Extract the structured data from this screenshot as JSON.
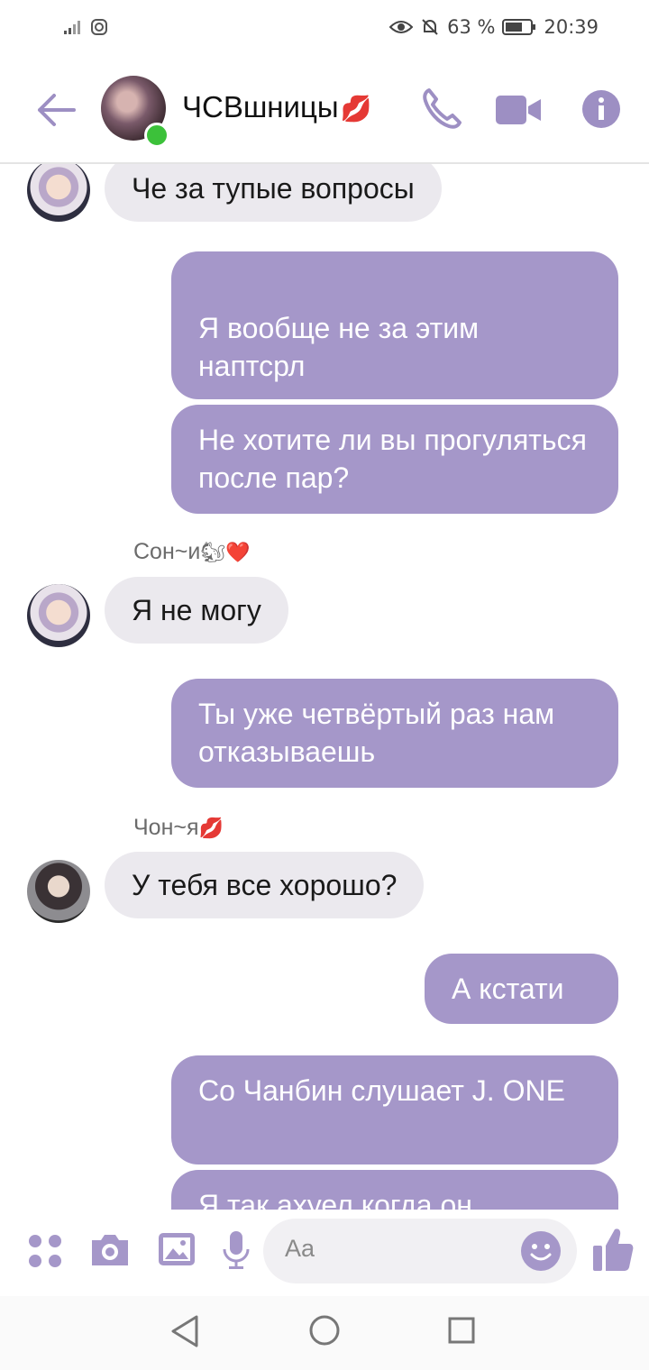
{
  "status_bar": {
    "battery": "63 %",
    "time": "20:39",
    "icons": [
      "signal-icon",
      "instagram-icon",
      "eye-icon",
      "bell-muted-icon",
      "battery-icon"
    ]
  },
  "header": {
    "title": "ЧСВшницы",
    "title_emoji": "💋",
    "icons": [
      "back-arrow-icon",
      "phone-icon",
      "video-camera-icon",
      "info-icon"
    ],
    "accent_color": "#a597c9"
  },
  "messages": [
    {
      "side": "in",
      "sender": "",
      "text": "Че за тупые вопросы"
    },
    {
      "side": "out",
      "text": "Я вообще не за этим наптсрл"
    },
    {
      "side": "out",
      "text": "Не хотите ли вы прогуляться после пар?"
    },
    {
      "side": "in",
      "sender": "Сон~и",
      "sender_emoji": "🐿❤️",
      "text": "Я не могу"
    },
    {
      "side": "out",
      "text": "Ты уже четвёртый раз нам отказываешь"
    },
    {
      "side": "in",
      "sender": "Чон~я",
      "sender_emoji": "💋",
      "text": "У тебя все хорошо?"
    },
    {
      "side": "out",
      "text": "А кстати"
    },
    {
      "side": "out",
      "text": "Со Чанбин слушает J. ONE"
    },
    {
      "side": "out",
      "text": "Я так ахуел когда он"
    }
  ],
  "composer": {
    "placeholder": "Aa",
    "icons": [
      "apps-icon",
      "camera-icon",
      "gallery-icon",
      "microphone-icon",
      "emoji-icon",
      "thumbs-up-icon"
    ]
  },
  "nav_bar": {
    "icons": [
      "nav-back-icon",
      "nav-home-icon",
      "nav-recents-icon"
    ]
  }
}
